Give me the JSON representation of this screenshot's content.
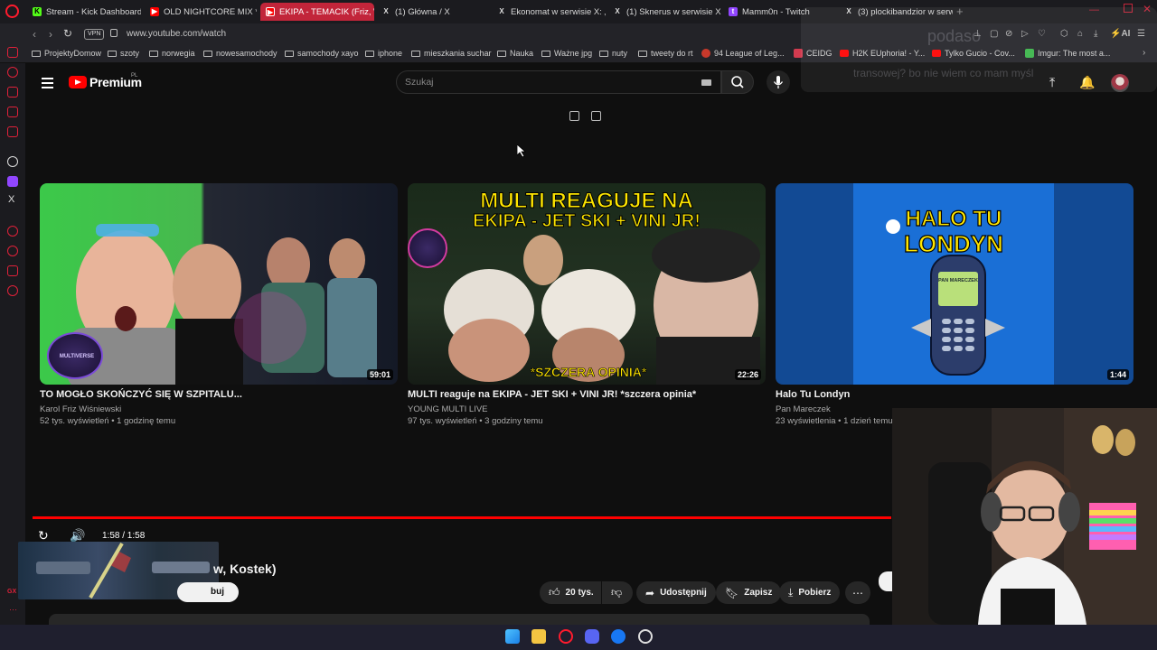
{
  "browser": {
    "tabs": [
      {
        "label": "Stream - Kick Dashboard",
        "icon": "kick-icon",
        "active": false
      },
      {
        "label": "OLD NIGHTCORE MIX *20",
        "icon": "youtube-icon",
        "active": false
      },
      {
        "label": "EKIPA - TEMACIK (Friz, W",
        "icon": "youtube-icon",
        "active": true
      },
      {
        "label": "(1) Główna / X",
        "icon": "x-icon",
        "active": false
      },
      {
        "label": "Ekonomat w serwisie X: „",
        "icon": "x-icon",
        "active": false
      },
      {
        "label": "(1) Sknerus w serwisie X",
        "icon": "x-icon",
        "active": false
      },
      {
        "label": "Mamm0n - Twitch",
        "icon": "twitch-icon",
        "active": false
      },
      {
        "label": "(3) plockibandzior w serw",
        "icon": "x-icon",
        "active": false
      }
    ],
    "vpn_label": "VPN",
    "url": "www.youtube.com/watch",
    "ai_label": "AI",
    "bookmarks": [
      "ProjektyDomow",
      "szoty",
      "norwegia",
      "nowesamochody",
      "samochody xayo",
      "iphone",
      "mieszkania suchar",
      "Nauka",
      "Ważne jpg",
      "nuty",
      "tweety do rt",
      "94 League of Leg...",
      "CEIDG",
      "H2K EUphoria! - Y...",
      "Tylko Gucio - Cov...",
      "Imgur: The most a..."
    ]
  },
  "overlay_ghost": {
    "line1": "podaso",
    "line2": "transowej? bo nie wiem co mam myśl"
  },
  "youtube": {
    "logo_text": "Premium",
    "region": "PL",
    "search_placeholder": "Szukaj",
    "videos": [
      {
        "title": "TO MOGŁO SKOŃCZYĆ SIĘ W SZPITALU...",
        "channel": "Karol Friz Wiśniewski",
        "meta": "52 tys. wyświetleń • 1 godzinę temu",
        "duration": "59:01",
        "badge": "MULTIVERSE"
      },
      {
        "title": "MULTI reaguje na EKIPA - JET SKI + VINI JR! *szczera opinia*",
        "channel": "YOUNG MULTI LIVE",
        "meta": "97 tys. wyświetleń • 3 godziny temu",
        "duration": "22:26",
        "thumb_headline_1": "MULTI REAGUJE NA",
        "thumb_headline_2": "EKIPA - JET SKI + VINI JR!",
        "thumb_footer": "*SZCZERA OPINIA*"
      },
      {
        "title": "Halo Tu Londyn",
        "channel": "Pan Mareczek",
        "meta": "23 wyświetlenia • 1 dzień temu",
        "duration": "1:44",
        "thumb_headline_1": "HALO TU",
        "thumb_headline_2": "LONDYN",
        "phone_screen": "PAN MARECZEK"
      }
    ],
    "player": {
      "time": "1:58 / 1:58",
      "progress": 1.0
    },
    "video_title_fragment": "w, Kostek)",
    "subscribe_fragment": "buj",
    "likes": "20 tys.",
    "share_label": "Udostępnij",
    "save_label": "Zapisz",
    "download_label": "Pobierz"
  }
}
